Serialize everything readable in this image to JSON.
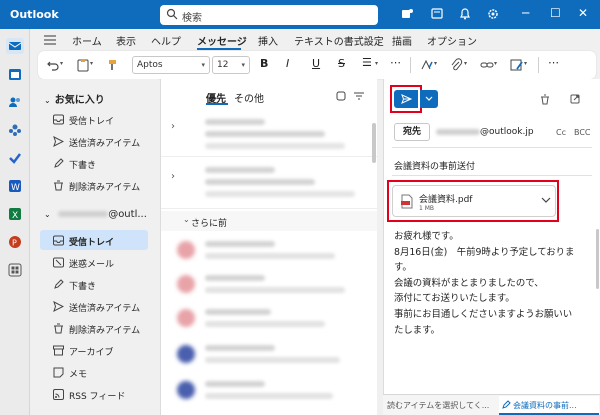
{
  "titlebar": {
    "app_title": "Outlook",
    "search_placeholder": "検索"
  },
  "menu": {
    "items": [
      "ホーム",
      "表示",
      "ヘルプ",
      "メッセージ",
      "挿入",
      "テキストの書式設定",
      "描画",
      "オプション"
    ],
    "active": "メッセージ"
  },
  "ribbon": {
    "font_name": "Aptos",
    "font_size": "12"
  },
  "folders": {
    "favorites_title": "お気に入り",
    "favorites": [
      "受信トレイ",
      "送信済みアイテム",
      "下書き",
      "削除済みアイテム"
    ],
    "account_suffix": "@outl...",
    "account_items": [
      "受信トレイ",
      "迷惑メール",
      "下書き",
      "送信済みアイテム",
      "削除済みアイテム",
      "アーカイブ",
      "メモ",
      "RSS フィード"
    ],
    "selected": "受信トレイ"
  },
  "list": {
    "tab_focused": "優先",
    "tab_other": "その他",
    "section_label": "さらに前"
  },
  "compose": {
    "to_label": "宛先",
    "to_domain": "@outlook.jp",
    "cc_label": "Cc",
    "bcc_label": "BCC",
    "subject": "会議資料の事前送付",
    "attachment": {
      "name": "会議資料.pdf",
      "size": "1 MB"
    },
    "body_lines": [
      "お疲れ様です。",
      "8月16日(金)　午前9時より予定しておりま",
      "す。",
      "会議の資料がまとまりましたので、",
      "添付にてお送りいたします。",
      "事前にお目通しくださいますようお願いい",
      "たします。"
    ]
  },
  "statusbar": {
    "left_text": "読むアイテムを選択してく...",
    "tab_label": "会議資料の事前..."
  },
  "colors": {
    "accent": "#0f6cbd",
    "highlight": "#e3001b",
    "selected_bg": "#cfe4fa"
  }
}
